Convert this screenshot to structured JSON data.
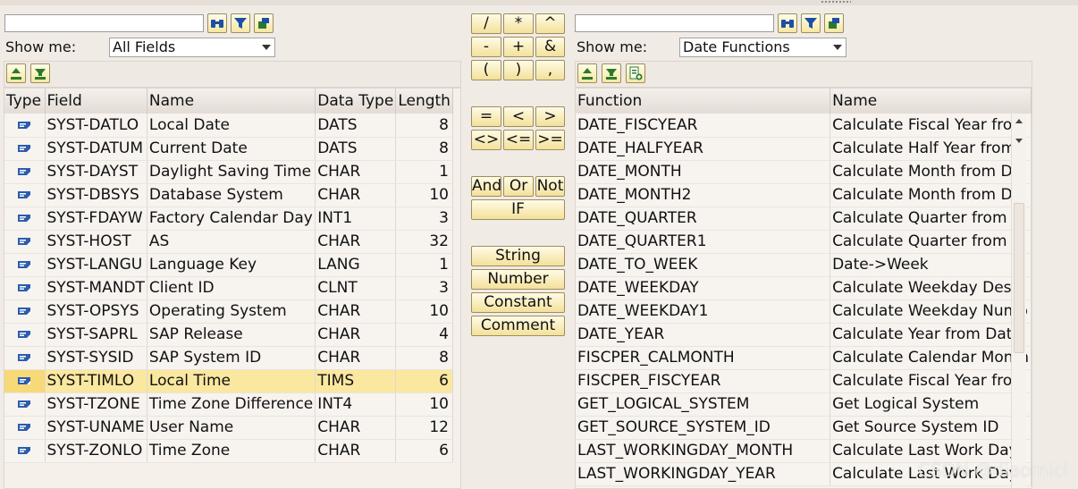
{
  "left": {
    "search": {
      "value": "",
      "placeholder": ""
    },
    "toolbar_icons": [
      "binoculars-icon",
      "filter-icon",
      "settings-icon"
    ],
    "show_me_label": "Show me:",
    "show_me_value": "All Fields",
    "sub_toolbar_icons": [
      "sort-ascending-icon",
      "filter-icon"
    ],
    "columns": [
      "Type",
      "Field",
      "Name",
      "Data Type",
      "Length"
    ],
    "rows": [
      {
        "field": "SYST-DATLO",
        "name": "Local Date",
        "data_type": "DATS",
        "length": "8"
      },
      {
        "field": "SYST-DATUM",
        "name": "Current Date",
        "data_type": "DATS",
        "length": "8"
      },
      {
        "field": "SYST-DAYST",
        "name": "Daylight Saving Time",
        "data_type": "CHAR",
        "length": "1"
      },
      {
        "field": "SYST-DBSYS",
        "name": "Database System",
        "data_type": "CHAR",
        "length": "10"
      },
      {
        "field": "SYST-FDAYW",
        "name": "Factory Calendar Day",
        "data_type": "INT1",
        "length": "3"
      },
      {
        "field": "SYST-HOST",
        "name": "AS",
        "data_type": "CHAR",
        "length": "32"
      },
      {
        "field": "SYST-LANGU",
        "name": "Language Key",
        "data_type": "LANG",
        "length": "1"
      },
      {
        "field": "SYST-MANDT",
        "name": "Client ID",
        "data_type": "CLNT",
        "length": "3"
      },
      {
        "field": "SYST-OPSYS",
        "name": "Operating System",
        "data_type": "CHAR",
        "length": "10"
      },
      {
        "field": "SYST-SAPRL",
        "name": "SAP Release",
        "data_type": "CHAR",
        "length": "4"
      },
      {
        "field": "SYST-SYSID",
        "name": "SAP System ID",
        "data_type": "CHAR",
        "length": "8"
      },
      {
        "field": "SYST-TIMLO",
        "name": "Local Time",
        "data_type": "TIMS",
        "length": "6",
        "selected": true
      },
      {
        "field": "SYST-TZONE",
        "name": "Time Zone Difference",
        "data_type": "INT4",
        "length": "10"
      },
      {
        "field": "SYST-UNAME",
        "name": "User Name",
        "data_type": "CHAR",
        "length": "12"
      },
      {
        "field": "SYST-ZONLO",
        "name": "Time Zone",
        "data_type": "CHAR",
        "length": "6"
      }
    ]
  },
  "operators": {
    "arith": [
      "/",
      "*",
      "^",
      "-",
      "+",
      "&",
      "(",
      ")",
      ","
    ],
    "compare": [
      "=",
      "<",
      ">",
      "<>",
      "<=",
      ">="
    ],
    "logic": [
      "And",
      "Or",
      "Not"
    ],
    "if": "IF",
    "types": [
      "String",
      "Number",
      "Constant",
      "Comment"
    ]
  },
  "right": {
    "search": {
      "value": "",
      "placeholder": ""
    },
    "toolbar_icons": [
      "binoculars-icon",
      "filter-icon",
      "settings-icon"
    ],
    "show_me_label": "Show me:",
    "show_me_value": "Date Functions",
    "sub_toolbar_icons": [
      "sort-ascending-icon",
      "filter-icon",
      "add-icon"
    ],
    "columns": [
      "Function",
      "Name"
    ],
    "rows": [
      {
        "function": "DATE_FISCYEAR",
        "name": "Calculate Fiscal Year from"
      },
      {
        "function": "DATE_HALFYEAR",
        "name": "Calculate Half Year from"
      },
      {
        "function": "DATE_MONTH",
        "name": "Calculate Month from Da"
      },
      {
        "function": "DATE_MONTH2",
        "name": "Calculate Month from Da"
      },
      {
        "function": "DATE_QUARTER",
        "name": "Calculate Quarter from D"
      },
      {
        "function": "DATE_QUARTER1",
        "name": "Calculate Quarter from D"
      },
      {
        "function": "DATE_TO_WEEK",
        "name": "Date->Week"
      },
      {
        "function": "DATE_WEEKDAY",
        "name": "Calculate Weekday Descr"
      },
      {
        "function": "DATE_WEEKDAY1",
        "name": "Calculate Weekday Numb"
      },
      {
        "function": "DATE_YEAR",
        "name": "Calculate Year from Date"
      },
      {
        "function": "FISCPER_CALMONTH",
        "name": "Calculate Calendar Month"
      },
      {
        "function": "FISCPER_FISCYEAR",
        "name": "Calculate Fiscal Year from"
      },
      {
        "function": "GET_LOGICAL_SYSTEM",
        "name": "Get Logical System"
      },
      {
        "function": "GET_SOURCE_SYSTEM_ID",
        "name": "Get Source System ID"
      },
      {
        "function": "LAST_WORKINGDAY_MONTH",
        "name": "Calculate Last Work Day"
      },
      {
        "function": "LAST_WORKINGDAY_YEAR",
        "name": "Calculate Last Work Day"
      }
    ]
  },
  "watermark": "CSDN @diaomici"
}
